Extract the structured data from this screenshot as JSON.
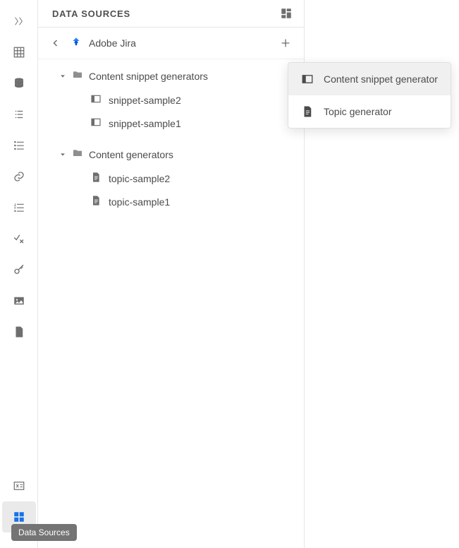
{
  "panel": {
    "title": "DATA SOURCES"
  },
  "breadcrumb": {
    "source": "Adobe Jira"
  },
  "tree": {
    "folders": [
      {
        "label": "Content snippet generators",
        "items": [
          {
            "label": "snippet-sample2",
            "type": "snippet"
          },
          {
            "label": "snippet-sample1",
            "type": "snippet"
          }
        ]
      },
      {
        "label": "Content generators",
        "items": [
          {
            "label": "topic-sample2",
            "type": "topic"
          },
          {
            "label": "topic-sample1",
            "type": "topic"
          }
        ]
      }
    ]
  },
  "dropdown": {
    "items": [
      {
        "label": "Content snippet generator",
        "icon": "panel",
        "active": true
      },
      {
        "label": "Topic generator",
        "icon": "file",
        "active": false
      }
    ]
  },
  "tooltip": {
    "text": "Data Sources"
  }
}
